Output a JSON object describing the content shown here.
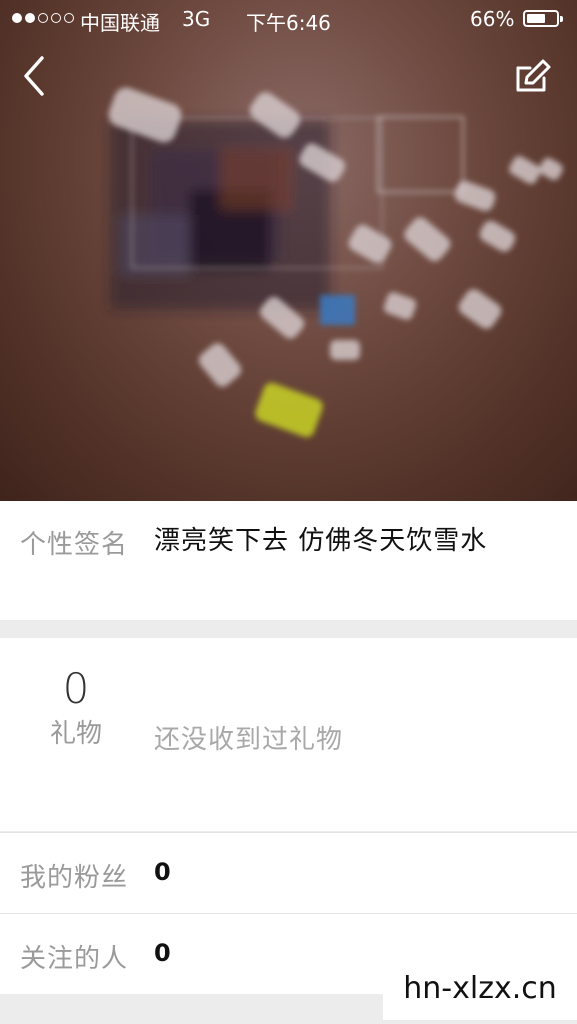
{
  "status_bar": {
    "carrier": "中国联通",
    "network": "3G",
    "time": "下午6:46",
    "battery_percent": "66%",
    "battery_level": 0.66,
    "signal_bars_filled": 2,
    "signal_bars_total": 5
  },
  "header": {
    "back_icon": "chevron-left-icon",
    "edit_icon": "edit-icon"
  },
  "profile": {
    "signature_label": "个性签名",
    "signature_text": "漂亮笑下去 仿佛冬天饮雪水"
  },
  "gifts": {
    "count": "0",
    "label": "礼物",
    "empty_text": "还没收到过礼物"
  },
  "stats": {
    "fans_label": "我的粉丝",
    "fans_value": "0",
    "following_label": "关注的人",
    "following_value": "0"
  },
  "watermark": "hn-xlzx.cn",
  "colors": {
    "label_gray": "#9a9a9a",
    "text_dark": "#111111",
    "divider": "#e3e3e3",
    "background": "#ececec"
  }
}
